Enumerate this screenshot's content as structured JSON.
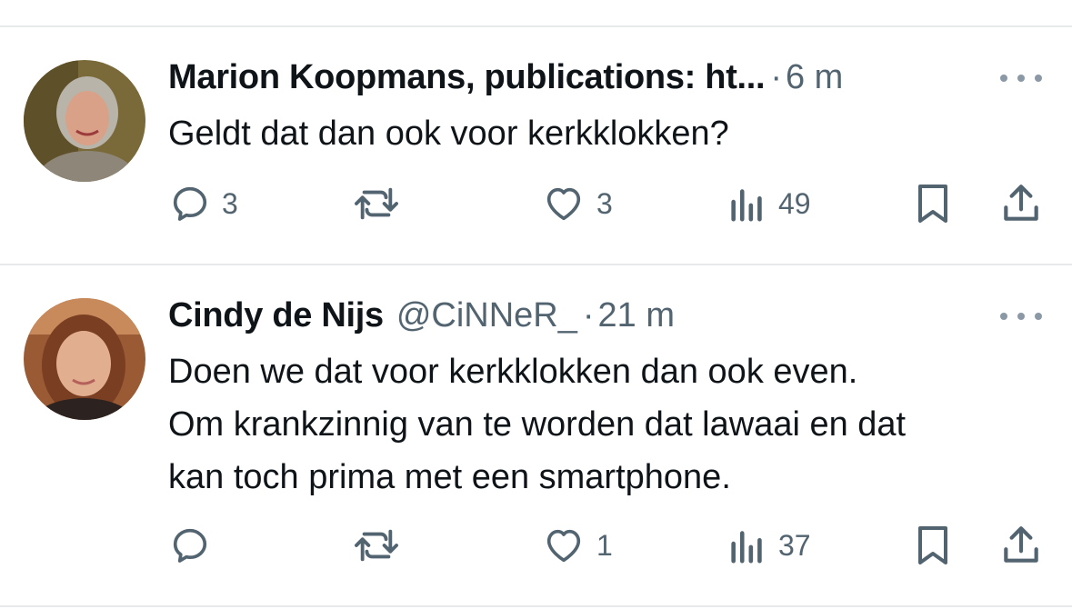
{
  "tweets": [
    {
      "name": "Marion Koopmans, publications: ht...",
      "handle": "",
      "dot": "·",
      "time": "6 m",
      "text_lines": [
        "Geldt dat dan ook voor kerkklokken?"
      ],
      "actions": {
        "replies": "3",
        "reposts": "",
        "likes": "3",
        "views": "49"
      },
      "avatar_colors": {
        "bg": "#7a6a3a",
        "hair": "#b9b4aa",
        "skin": "#d8a188",
        "clothes": "#8e8678"
      }
    },
    {
      "name": "Cindy de Nijs",
      "handle": "@CiNNeR_",
      "dot": "·",
      "time": "21 m",
      "text_lines": [
        "Doen we dat voor kerkklokken dan ook even.",
        "Om krankzinnig van te worden dat lawaai en dat",
        "kan toch prima met een smartphone."
      ],
      "actions": {
        "replies": "",
        "reposts": "",
        "likes": "1",
        "views": "37"
      },
      "avatar_colors": {
        "bg": "#9a5a34",
        "hair": "#7a3e22",
        "skin": "#e2ae90",
        "clothes": "#2c2220"
      }
    }
  ],
  "colors": {
    "icon": "#536471",
    "divider": "#e7e9ea",
    "text": "#0f1419",
    "muted": "#536471"
  },
  "icons": [
    "reply-icon",
    "repost-icon",
    "like-icon",
    "views-icon",
    "bookmark-icon",
    "share-icon",
    "more-icon"
  ]
}
